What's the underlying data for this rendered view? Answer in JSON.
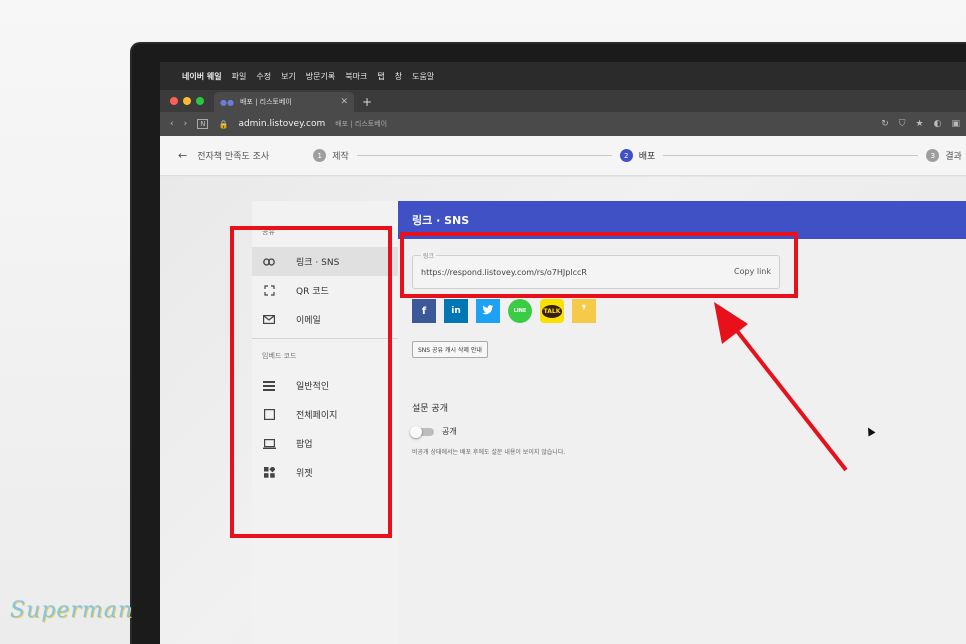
{
  "menubar": {
    "items": [
      "네이버 웨일",
      "파일",
      "수정",
      "보기",
      "방문기록",
      "북마크",
      "탭",
      "창",
      "도움말"
    ]
  },
  "browser": {
    "tab_title": "배포 | 리스토베이",
    "url": "admin.listovey.com",
    "url_sub": "배포 | 리스토베이"
  },
  "header": {
    "survey_title": "전자책 만족도 조사",
    "steps": [
      {
        "num": "1",
        "label": "제작"
      },
      {
        "num": "2",
        "label": "배포"
      },
      {
        "num": "3",
        "label": "결과"
      }
    ]
  },
  "sidebar": {
    "share_label": "공유",
    "share_items": [
      {
        "label": "링크 · SNS",
        "icon": "link-icon"
      },
      {
        "label": "QR 코드",
        "icon": "qr-scan-icon"
      },
      {
        "label": "이메일",
        "icon": "mail-icon"
      }
    ],
    "embed_label": "임베드 코드",
    "embed_items": [
      {
        "label": "일반적인",
        "icon": "list-layout-icon"
      },
      {
        "label": "전체페이지",
        "icon": "square-icon"
      },
      {
        "label": "팝업",
        "icon": "laptop-icon"
      },
      {
        "label": "위젯",
        "icon": "widget-icon"
      }
    ]
  },
  "main": {
    "title": "링크 · SNS",
    "link_legend": "링크",
    "link_url": "https://respond.listovey.com/rs/o7HJplccR",
    "copy_label": "Copy link",
    "cache_button": "SNS 공유 캐시 삭제 안내",
    "publish_title": "설문 공개",
    "toggle_label": "공개",
    "hint": "비공개 상태에서는 배포 후에도 설문 내용이 보이지 않습니다."
  },
  "share_buttons": [
    {
      "name": "facebook",
      "glyph": "f",
      "color": "#3b5998"
    },
    {
      "name": "linkedin",
      "glyph": "in",
      "color": "#0077b5"
    },
    {
      "name": "twitter",
      "glyph": "🐦",
      "color": "#1da1f2"
    },
    {
      "name": "line",
      "glyph": "LINE",
      "color": "#3acd44"
    },
    {
      "name": "kakaotalk",
      "glyph": "TALK",
      "color": "#f9e000"
    },
    {
      "name": "kakaostory",
      "glyph": "❜",
      "color": "#f7c948"
    }
  ],
  "watermark": "Superman",
  "colors": {
    "accent": "#3f51c5",
    "annotation_red": "#e8101a"
  }
}
